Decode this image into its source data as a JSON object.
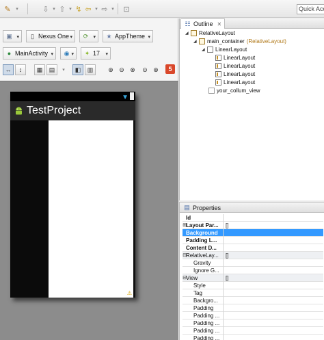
{
  "toolbar": {
    "quick_access_placeholder": "Quick Acc"
  },
  "editor": {
    "device_combo": "Nexus One",
    "theme_combo": "AppTheme",
    "activity_combo": "MainActivity",
    "api_combo": "17",
    "error_count": "5"
  },
  "device_preview": {
    "app_title": "TestProject"
  },
  "outline": {
    "tab_label": "Outline",
    "nodes": [
      {
        "label": "RelativeLayout",
        "extra": ""
      },
      {
        "label": "main_container",
        "extra": "(RelativeLayout)"
      },
      {
        "label": "LinearLayout",
        "extra": ""
      },
      {
        "label": "LinearLayout",
        "extra": ""
      },
      {
        "label": "LinearLayout",
        "extra": ""
      },
      {
        "label": "LinearLayout",
        "extra": ""
      },
      {
        "label": "LinearLayout",
        "extra": ""
      },
      {
        "label": "your_collum_view",
        "extra": ""
      }
    ]
  },
  "properties": {
    "tab_label": "Properties",
    "rows": [
      {
        "key": "Id",
        "value": ""
      },
      {
        "key": "Layout Par...",
        "value": "[]"
      },
      {
        "key": "Background",
        "value": ""
      },
      {
        "key": "Padding L...",
        "value": ""
      },
      {
        "key": "Content D...",
        "value": ""
      },
      {
        "key": "RelativeLay...",
        "value": "[]"
      },
      {
        "key": "Gravity",
        "value": ""
      },
      {
        "key": "Ignore G...",
        "value": ""
      },
      {
        "key": "View",
        "value": "[]"
      },
      {
        "key": "Style",
        "value": ""
      },
      {
        "key": "Tag",
        "value": ""
      },
      {
        "key": "Backgro...",
        "value": ""
      },
      {
        "key": "Padding",
        "value": ""
      },
      {
        "key": "Padding ...",
        "value": ""
      },
      {
        "key": "Padding ...",
        "value": ""
      },
      {
        "key": "Padding ...",
        "value": ""
      },
      {
        "key": "Padding ...",
        "value": ""
      }
    ]
  }
}
